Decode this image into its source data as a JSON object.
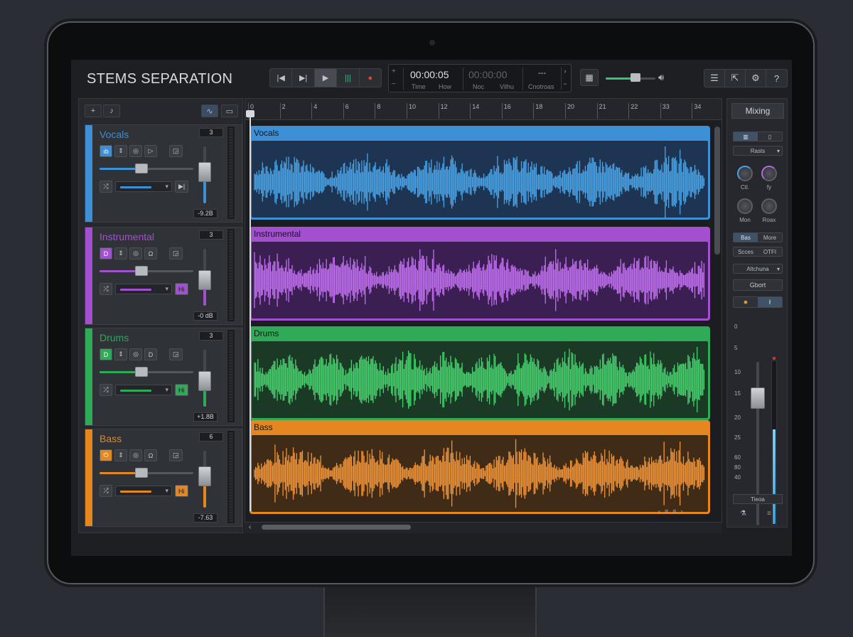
{
  "app": {
    "title": "STEMS SEPARATION"
  },
  "transport": {
    "buttons": [
      {
        "name": "skip-back-button",
        "icon": "skip-back-icon",
        "glyph": "|◀"
      },
      {
        "name": "step-forward-button",
        "icon": "step-forward-icon",
        "glyph": "▶|"
      },
      {
        "name": "play-button",
        "icon": "play-icon",
        "glyph": "▶"
      },
      {
        "name": "loop-button",
        "icon": "loop-icon",
        "glyph": "|||"
      },
      {
        "name": "record-button",
        "icon": "record-icon",
        "glyph": "●"
      }
    ]
  },
  "time": {
    "current": "00:00:05",
    "total": "00:00:00",
    "dash": "---",
    "labels": [
      "Time",
      "How",
      "Noc",
      "Vilhu",
      "Cnotroas"
    ],
    "plus": "+",
    "minus": "−",
    "up": "›",
    "down": "−"
  },
  "master_volume": {
    "level": 0.6,
    "icon": "speaker-icon"
  },
  "header_tools": [
    {
      "name": "mixer-button",
      "icon": "sliders-icon",
      "glyph": "☰"
    },
    {
      "name": "export-button",
      "icon": "export-icon",
      "glyph": "⇱"
    },
    {
      "name": "settings-button",
      "icon": "gear-icon",
      "glyph": "⚙"
    },
    {
      "name": "help-button",
      "icon": "help-icon",
      "glyph": "?"
    }
  ],
  "toolbar": {
    "add": "+",
    "note": "♪",
    "waveform": "∿",
    "folder": "▭"
  },
  "tracks": [
    {
      "name": "Vocals",
      "number": "3",
      "gain": "-9.2B",
      "color": "#3d8fd6",
      "clip_fill": "#1d3552",
      "wave_color": "#4aa3e6",
      "pan": 0.45,
      "fader": 0.55,
      "btn1": "ıb",
      "btn4": "▷",
      "btn5": "◲",
      "btn6": "▶|",
      "fx_icon": "shuffle-icon"
    },
    {
      "name": "Instrumental",
      "number": "3",
      "gain": "-0 dB",
      "color": "#a24fd0",
      "clip_fill": "#3c1f52",
      "wave_color": "#c170f0",
      "pan": 0.45,
      "fader": 0.45,
      "btn1": "D",
      "btn4": "Ω",
      "btn5": "◲",
      "btn6": "Hi",
      "fx_icon": "shuffle-icon"
    },
    {
      "name": "Drums",
      "number": "3",
      "gain": "+1.8B",
      "color": "#2faa56",
      "clip_fill": "#1b3a25",
      "wave_color": "#47d16e",
      "pan": 0.45,
      "fader": 0.45,
      "btn1": "D",
      "btn4": "D",
      "btn5": "◲",
      "btn6": "Hi",
      "fx_icon": "shuffle-icon"
    },
    {
      "name": "Bass",
      "number": "6",
      "gain": "-7.63",
      "color": "#e5861e",
      "clip_fill": "#3f2b16",
      "wave_color": "#f0943a",
      "pan": 0.45,
      "fader": 0.55,
      "btn1": "⏻",
      "btn4": "Ω",
      "btn5": "◲",
      "btn6": "Hi",
      "fx_icon": "shuffle-icon"
    }
  ],
  "ruler": {
    "ticks": [
      "0",
      "2",
      "4",
      "6",
      "8",
      "10",
      "12",
      "14",
      "16",
      "18",
      "20",
      "21",
      "22",
      "33",
      "34"
    ]
  },
  "mixing": {
    "title": "Mixing",
    "view_toggle": [
      "▥",
      "▯"
    ],
    "preset_dropdown": "Rasts",
    "knobs": [
      {
        "label": "Ctl.",
        "style": "blue"
      },
      {
        "label": "fy",
        "style": "purple"
      },
      {
        "label": "Mon",
        "style": "plain"
      },
      {
        "label": "Roax",
        "style": "plain"
      }
    ],
    "seg1": [
      "Bas",
      "More"
    ],
    "seg2": [
      "Scces",
      "OTFI"
    ],
    "attach_dropdown": "Altchuna",
    "abort_button": "Gbort",
    "fx_toggle": [
      "✹",
      "⫲"
    ],
    "scale": [
      "0",
      "5",
      "10",
      "15",
      "20",
      "25",
      "60",
      "80",
      "40"
    ],
    "meter_level": 0.58,
    "footer": "Tieoa",
    "bottom_icons": [
      "⚗",
      "≡"
    ]
  },
  "zoom_controls": [
    "‹",
    "≡",
    "≡",
    "›"
  ],
  "scroll_left": "‹"
}
